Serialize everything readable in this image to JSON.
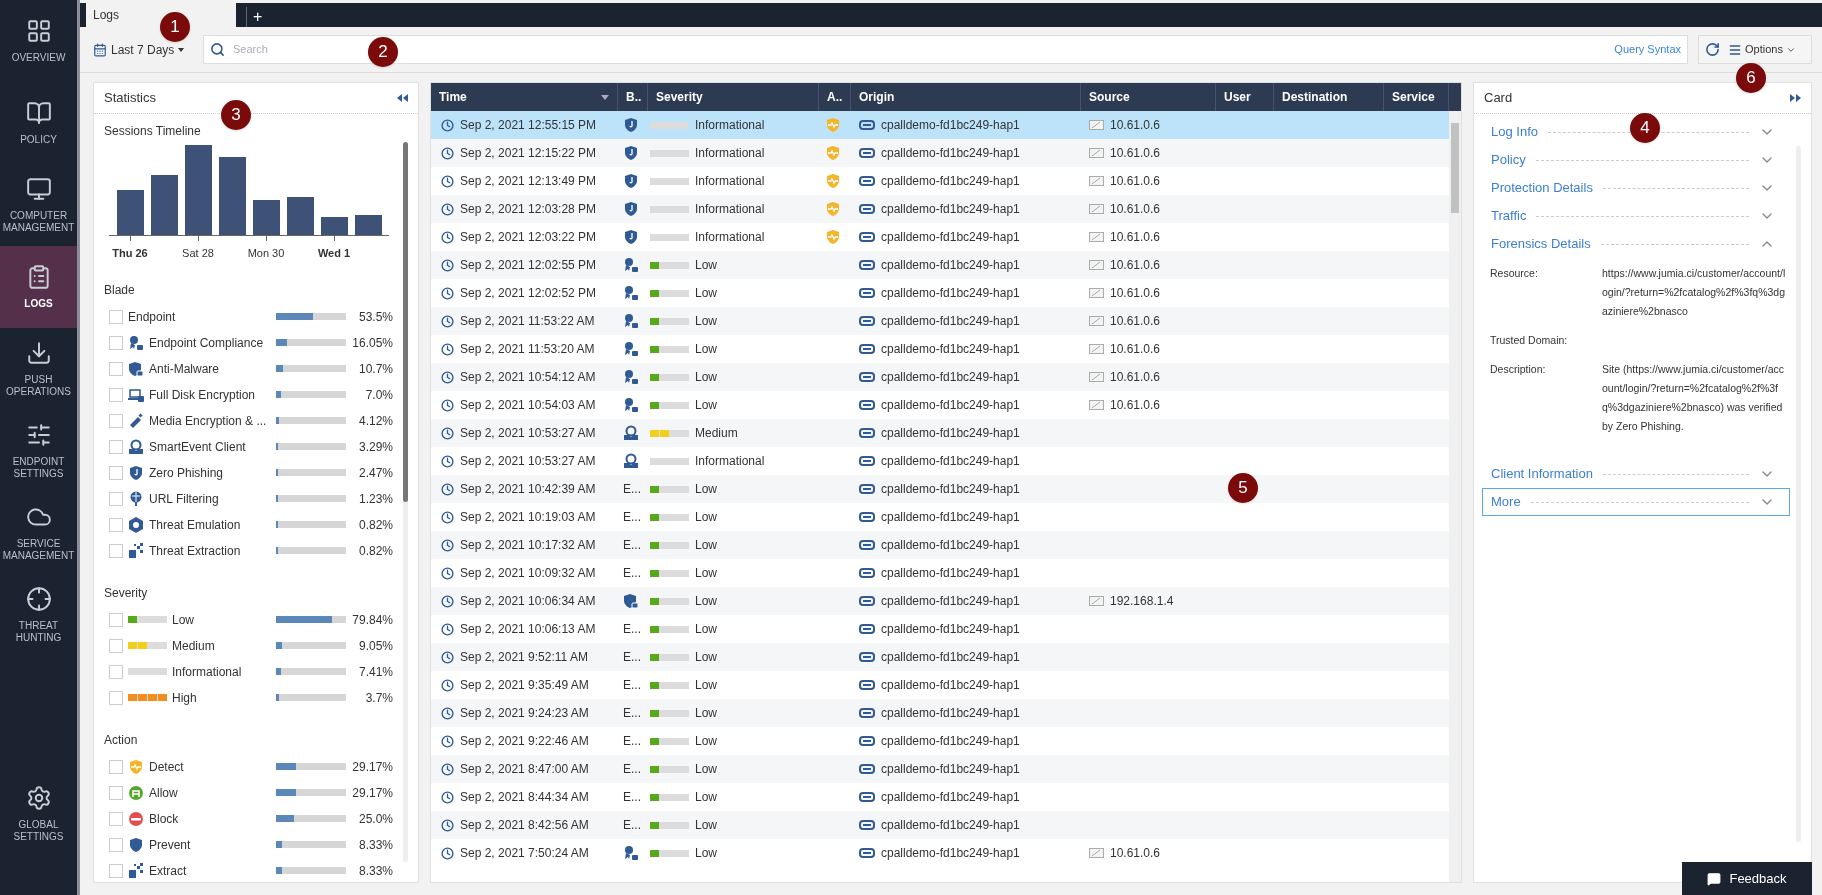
{
  "nav": {
    "items": [
      {
        "kind": "overview",
        "label": "OVERVIEW",
        "selected": false
      },
      {
        "kind": "policy",
        "label": "POLICY",
        "selected": false
      },
      {
        "kind": "computer",
        "label": "COMPUTER MANAGEMENT",
        "selected": false
      },
      {
        "kind": "logs",
        "label": "LOGS",
        "selected": true
      },
      {
        "kind": "push",
        "label": "PUSH OPERATIONS",
        "selected": false
      },
      {
        "kind": "settings",
        "label": "ENDPOINT SETTINGS",
        "selected": false
      },
      {
        "kind": "service",
        "label": "SERVICE MANAGEMENT",
        "selected": false
      },
      {
        "kind": "hunting",
        "label": "THREAT HUNTING",
        "selected": false
      }
    ],
    "bottom": {
      "kind": "global",
      "label": "GLOBAL SETTINGS",
      "selected": false
    }
  },
  "tabs": [
    {
      "label": "Logs",
      "selected": true
    }
  ],
  "add_tab": "+",
  "toolbar": {
    "range": "Last 7 Days",
    "search": {
      "placeholder": "Search"
    },
    "query_syntax": "Query Syntax",
    "options": "Options"
  },
  "statistics": {
    "title": "Statistics",
    "timeline": {
      "title": "Sessions Timeline",
      "labels": [
        {
          "text": "Thu 26",
          "bold": true
        },
        {
          "text": "Sat 28",
          "bold": false
        },
        {
          "text": "Mon 30",
          "bold": false
        },
        {
          "text": "Wed 1",
          "bold": true
        }
      ]
    },
    "groups": [
      {
        "title": "Blade",
        "items": [
          {
            "kind": "none",
            "label": "Endpoint",
            "level": 0.535,
            "value": "53.5%",
            "checked": false
          },
          {
            "kind": "compliance",
            "label": "Endpoint Compliance",
            "level": 0.16,
            "value": "16.05%",
            "checked": false
          },
          {
            "kind": "antimalware",
            "label": "Anti-Malware",
            "level": 0.107,
            "value": "10.7%",
            "checked": false
          },
          {
            "kind": "disk",
            "label": "Full Disk Encryption",
            "level": 0.07,
            "value": "7.0%",
            "checked": false
          },
          {
            "kind": "media",
            "label": "Media Encryption & ...",
            "level": 0.041,
            "value": "4.12%",
            "checked": false
          },
          {
            "kind": "smartevent",
            "label": "SmartEvent Client",
            "level": 0.033,
            "value": "3.29%",
            "checked": false
          },
          {
            "kind": "phishing",
            "label": "Zero Phishing",
            "level": 0.025,
            "value": "2.47%",
            "checked": false
          },
          {
            "kind": "url",
            "label": "URL Filtering",
            "level": 0.012,
            "value": "1.23%",
            "checked": false
          },
          {
            "kind": "emulation",
            "label": "Threat Emulation",
            "level": 0.008,
            "value": "0.82%",
            "checked": false
          },
          {
            "kind": "extraction",
            "label": "Threat Extraction",
            "level": 0.008,
            "value": "0.82%",
            "checked": false
          }
        ]
      },
      {
        "title": "Severity",
        "items": [
          {
            "kind": "low",
            "label": "Low",
            "level": 0.798,
            "value": "79.84%",
            "checked": false
          },
          {
            "kind": "medium",
            "label": "Medium",
            "level": 0.09,
            "value": "9.05%",
            "checked": false
          },
          {
            "kind": "info",
            "label": "Informational",
            "level": 0.074,
            "value": "7.41%",
            "checked": false
          },
          {
            "kind": "high",
            "label": "High",
            "level": 0.037,
            "value": "3.7%",
            "checked": false
          }
        ]
      },
      {
        "title": "Action",
        "items": [
          {
            "kind": "detect",
            "label": "Detect",
            "level": 0.29,
            "value": "29.17%",
            "checked": false
          },
          {
            "kind": "allow",
            "label": "Allow",
            "level": 0.29,
            "value": "29.17%",
            "checked": false
          },
          {
            "kind": "block",
            "label": "Block",
            "level": 0.25,
            "value": "25.0%",
            "checked": false
          },
          {
            "kind": "prevent",
            "label": "Prevent",
            "level": 0.083,
            "value": "8.33%",
            "checked": false
          },
          {
            "kind": "extraction",
            "label": "Extract",
            "level": 0.083,
            "value": "8.33%",
            "checked": false
          }
        ]
      }
    ]
  },
  "table": {
    "columns": [
      "Time",
      "B..",
      "Severity",
      "A..",
      "Origin",
      "Source",
      "User",
      "Destination",
      "Service"
    ],
    "rows": [
      {
        "time": "Sep 2, 2021 12:55:15 PM",
        "blade": {
          "kind": "phishing"
        },
        "severity": {
          "kind": "info",
          "label": "Informational"
        },
        "action": {
          "kind": "detect"
        },
        "origin": "cpalldemo-fd1bc249-hap1",
        "source": "10.61.0.6",
        "selected": true
      },
      {
        "time": "Sep 2, 2021 12:15:22 PM",
        "blade": {
          "kind": "phishing"
        },
        "severity": {
          "kind": "info",
          "label": "Informational"
        },
        "action": {
          "kind": "detect"
        },
        "origin": "cpalldemo-fd1bc249-hap1",
        "source": "10.61.0.6",
        "selected": false
      },
      {
        "time": "Sep 2, 2021 12:13:49 PM",
        "blade": {
          "kind": "phishing"
        },
        "severity": {
          "kind": "info",
          "label": "Informational"
        },
        "action": {
          "kind": "detect"
        },
        "origin": "cpalldemo-fd1bc249-hap1",
        "source": "10.61.0.6",
        "selected": false
      },
      {
        "time": "Sep 2, 2021 12:03:28 PM",
        "blade": {
          "kind": "phishing"
        },
        "severity": {
          "kind": "info",
          "label": "Informational"
        },
        "action": {
          "kind": "detect"
        },
        "origin": "cpalldemo-fd1bc249-hap1",
        "source": "10.61.0.6",
        "selected": false
      },
      {
        "time": "Sep 2, 2021 12:03:22 PM",
        "blade": {
          "kind": "phishing"
        },
        "severity": {
          "kind": "info",
          "label": "Informational"
        },
        "action": {
          "kind": "detect"
        },
        "origin": "cpalldemo-fd1bc249-hap1",
        "source": "10.61.0.6",
        "selected": false
      },
      {
        "time": "Sep 2, 2021 12:02:55 PM",
        "blade": {
          "kind": "compliance"
        },
        "severity": {
          "kind": "low",
          "label": "Low"
        },
        "origin": "cpalldemo-fd1bc249-hap1",
        "source": "10.61.0.6",
        "selected": false
      },
      {
        "time": "Sep 2, 2021 12:02:52 PM",
        "blade": {
          "kind": "compliance"
        },
        "severity": {
          "kind": "low",
          "label": "Low"
        },
        "origin": "cpalldemo-fd1bc249-hap1",
        "source": "10.61.0.6",
        "selected": false
      },
      {
        "time": "Sep 2, 2021 11:53:22 AM",
        "blade": {
          "kind": "compliance"
        },
        "severity": {
          "kind": "low",
          "label": "Low"
        },
        "origin": "cpalldemo-fd1bc249-hap1",
        "source": "10.61.0.6",
        "selected": false
      },
      {
        "time": "Sep 2, 2021 11:53:20 AM",
        "blade": {
          "kind": "compliance"
        },
        "severity": {
          "kind": "low",
          "label": "Low"
        },
        "origin": "cpalldemo-fd1bc249-hap1",
        "source": "10.61.0.6",
        "selected": false
      },
      {
        "time": "Sep 2, 2021 10:54:12 AM",
        "blade": {
          "kind": "compliance"
        },
        "severity": {
          "kind": "low",
          "label": "Low"
        },
        "origin": "cpalldemo-fd1bc249-hap1",
        "source": "10.61.0.6",
        "selected": false
      },
      {
        "time": "Sep 2, 2021 10:54:03 AM",
        "blade": {
          "kind": "compliance"
        },
        "severity": {
          "kind": "low",
          "label": "Low"
        },
        "origin": "cpalldemo-fd1bc249-hap1",
        "source": "10.61.0.6",
        "selected": false
      },
      {
        "time": "Sep 2, 2021 10:53:27 AM",
        "blade": {
          "kind": "smartevent"
        },
        "severity": {
          "kind": "medium",
          "label": "Medium"
        },
        "origin": "cpalldemo-fd1bc249-hap1",
        "selected": false
      },
      {
        "time": "Sep 2, 2021 10:53:27 AM",
        "blade": {
          "kind": "smartevent"
        },
        "severity": {
          "kind": "info",
          "label": "Informational"
        },
        "origin": "cpalldemo-fd1bc249-hap1",
        "selected": false
      },
      {
        "time": "Sep 2, 2021 10:42:39 AM",
        "blade": {
          "kind": "text",
          "text": "E..."
        },
        "severity": {
          "kind": "low",
          "label": "Low"
        },
        "origin": "cpalldemo-fd1bc249-hap1",
        "selected": false
      },
      {
        "time": "Sep 2, 2021 10:19:03 AM",
        "blade": {
          "kind": "text",
          "text": "E..."
        },
        "severity": {
          "kind": "low",
          "label": "Low"
        },
        "origin": "cpalldemo-fd1bc249-hap1",
        "selected": false
      },
      {
        "time": "Sep 2, 2021 10:17:32 AM",
        "blade": {
          "kind": "text",
          "text": "E..."
        },
        "severity": {
          "kind": "low",
          "label": "Low"
        },
        "origin": "cpalldemo-fd1bc249-hap1",
        "selected": false
      },
      {
        "time": "Sep 2, 2021 10:09:32 AM",
        "blade": {
          "kind": "text",
          "text": "E..."
        },
        "severity": {
          "kind": "low",
          "label": "Low"
        },
        "origin": "cpalldemo-fd1bc249-hap1",
        "selected": false
      },
      {
        "time": "Sep 2, 2021 10:06:34 AM",
        "blade": {
          "kind": "antimalware"
        },
        "severity": {
          "kind": "low",
          "label": "Low"
        },
        "origin": "cpalldemo-fd1bc249-hap1",
        "source": "192.168.1.4",
        "selected": false
      },
      {
        "time": "Sep 2, 2021 10:06:13 AM",
        "blade": {
          "kind": "text",
          "text": "E..."
        },
        "severity": {
          "kind": "low",
          "label": "Low"
        },
        "origin": "cpalldemo-fd1bc249-hap1",
        "selected": false
      },
      {
        "time": "Sep 2, 2021 9:52:11 AM",
        "blade": {
          "kind": "text",
          "text": "E..."
        },
        "severity": {
          "kind": "low",
          "label": "Low"
        },
        "origin": "cpalldemo-fd1bc249-hap1",
        "selected": false
      },
      {
        "time": "Sep 2, 2021 9:35:49 AM",
        "blade": {
          "kind": "text",
          "text": "E..."
        },
        "severity": {
          "kind": "low",
          "label": "Low"
        },
        "origin": "cpalldemo-fd1bc249-hap1",
        "selected": false
      },
      {
        "time": "Sep 2, 2021 9:24:23 AM",
        "blade": {
          "kind": "text",
          "text": "E..."
        },
        "severity": {
          "kind": "low",
          "label": "Low"
        },
        "origin": "cpalldemo-fd1bc249-hap1",
        "selected": false
      },
      {
        "time": "Sep 2, 2021 9:22:46 AM",
        "blade": {
          "kind": "text",
          "text": "E..."
        },
        "severity": {
          "kind": "low",
          "label": "Low"
        },
        "origin": "cpalldemo-fd1bc249-hap1",
        "selected": false
      },
      {
        "time": "Sep 2, 2021 8:47:00 AM",
        "blade": {
          "kind": "text",
          "text": "E..."
        },
        "severity": {
          "kind": "low",
          "label": "Low"
        },
        "origin": "cpalldemo-fd1bc249-hap1",
        "selected": false
      },
      {
        "time": "Sep 2, 2021 8:44:34 AM",
        "blade": {
          "kind": "text",
          "text": "E..."
        },
        "severity": {
          "kind": "low",
          "label": "Low"
        },
        "origin": "cpalldemo-fd1bc249-hap1",
        "selected": false
      },
      {
        "time": "Sep 2, 2021 8:42:56 AM",
        "blade": {
          "kind": "text",
          "text": "E..."
        },
        "severity": {
          "kind": "low",
          "label": "Low"
        },
        "origin": "cpalldemo-fd1bc249-hap1",
        "selected": false
      },
      {
        "time": "Sep 2, 2021 7:50:24 AM",
        "blade": {
          "kind": "compliance"
        },
        "severity": {
          "kind": "low",
          "label": "Low"
        },
        "origin": "cpalldemo-fd1bc249-hap1",
        "source": "10.61.0.6",
        "selected": false
      }
    ]
  },
  "card": {
    "title": "Card",
    "sections": [
      {
        "title": "Log Info",
        "expanded": false,
        "focused": false
      },
      {
        "title": "Policy",
        "expanded": false,
        "focused": false
      },
      {
        "title": "Protection Details",
        "expanded": false,
        "focused": false
      },
      {
        "title": "Traffic",
        "expanded": false,
        "focused": false
      },
      {
        "title": "Forensics Details",
        "expanded": true,
        "focused": false,
        "fields": [
          {
            "label": "Resource:",
            "value": "https://www.jumia.ci/customer/account/login/?return=%2fcatalog%2f%3fq%3dgaziniere%2bnasco"
          },
          {
            "label": "Trusted Domain:"
          },
          {
            "label": "Description:",
            "value": "Site (https://www.jumia.ci/customer/account/login/?return=%2fcatalog%2f%3fq%3dgaziniere%2bnasco) was verified by Zero Phishing."
          }
        ]
      },
      {
        "title": "Client Information",
        "expanded": false,
        "focused": false
      },
      {
        "title": "More",
        "expanded": false,
        "focused": true
      }
    ]
  },
  "feedback": "Feedback",
  "callouts": [
    "1",
    "2",
    "3",
    "4",
    "5",
    "6"
  ]
}
